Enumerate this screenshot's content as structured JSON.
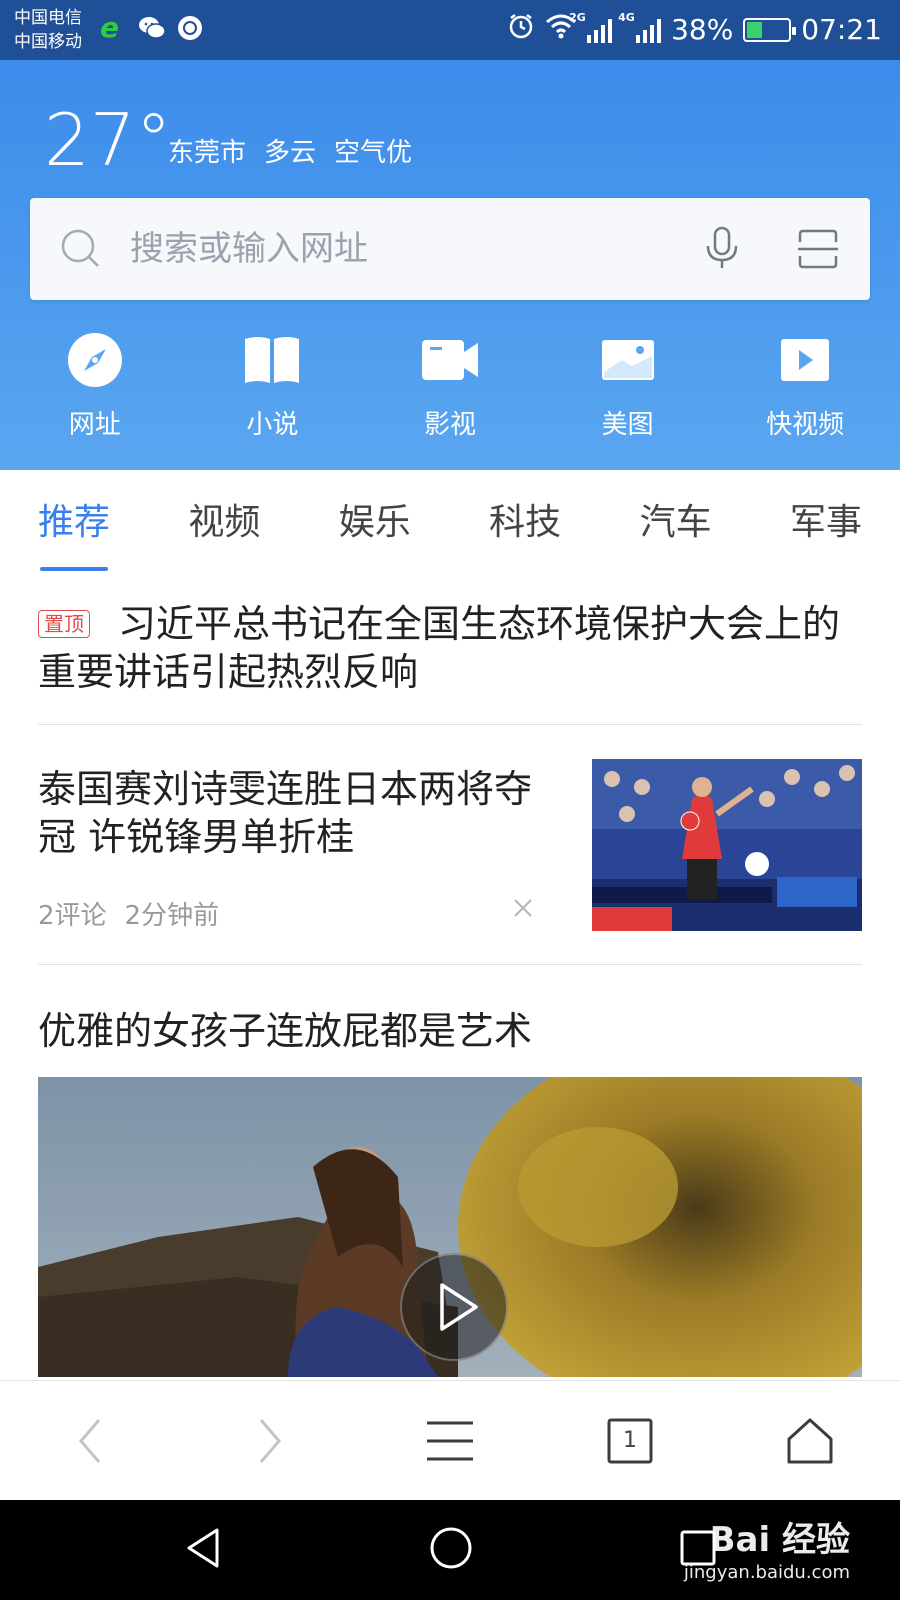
{
  "status_bar": {
    "carrier_1": "中国电信",
    "carrier_2": "中国移动",
    "network_1": "2G",
    "network_2": "4G",
    "battery": "38%",
    "battery_level": 0.38,
    "time": "07:21",
    "app_icons": [
      "browser-e-icon",
      "wechat-icon",
      "messenger-icon"
    ]
  },
  "weather": {
    "temperature": "27°",
    "city": "东莞市",
    "condition": "多云",
    "air_quality": "空气优"
  },
  "search": {
    "placeholder": "搜索或输入网址"
  },
  "quick_nav": [
    {
      "label": "网址",
      "icon": "compass-icon"
    },
    {
      "label": "小说",
      "icon": "book-icon"
    },
    {
      "label": "影视",
      "icon": "video-camera-icon"
    },
    {
      "label": "美图",
      "icon": "picture-icon"
    },
    {
      "label": "快视频",
      "icon": "play-video-icon"
    }
  ],
  "tabs": [
    {
      "label": "推荐",
      "active": true
    },
    {
      "label": "视频",
      "active": false
    },
    {
      "label": "娱乐",
      "active": false
    },
    {
      "label": "科技",
      "active": false
    },
    {
      "label": "汽车",
      "active": false
    },
    {
      "label": "军事",
      "active": false
    }
  ],
  "feed": {
    "pinned": {
      "badge": "置顶",
      "title": "习近平总书记在全国生态环境保护大会上的重要讲话引起热烈反响"
    },
    "news": {
      "title": "泰国赛刘诗雯连胜日本两将夺冠 许锐锋男单折桂",
      "comments": "2评论",
      "time": "2分钟前"
    },
    "video": {
      "title": "优雅的女孩子连放屁都是艺术"
    }
  },
  "toolbar": {
    "tab_count": "1"
  },
  "watermark": {
    "logo_text": "Bai 经验",
    "url": "jingyan.baidu.com"
  },
  "colors": {
    "header_blue": "#3b8ceb",
    "accent_blue": "#3a7ff0",
    "pin_red": "#e34a4a",
    "status_bar": "#1f4f96"
  }
}
